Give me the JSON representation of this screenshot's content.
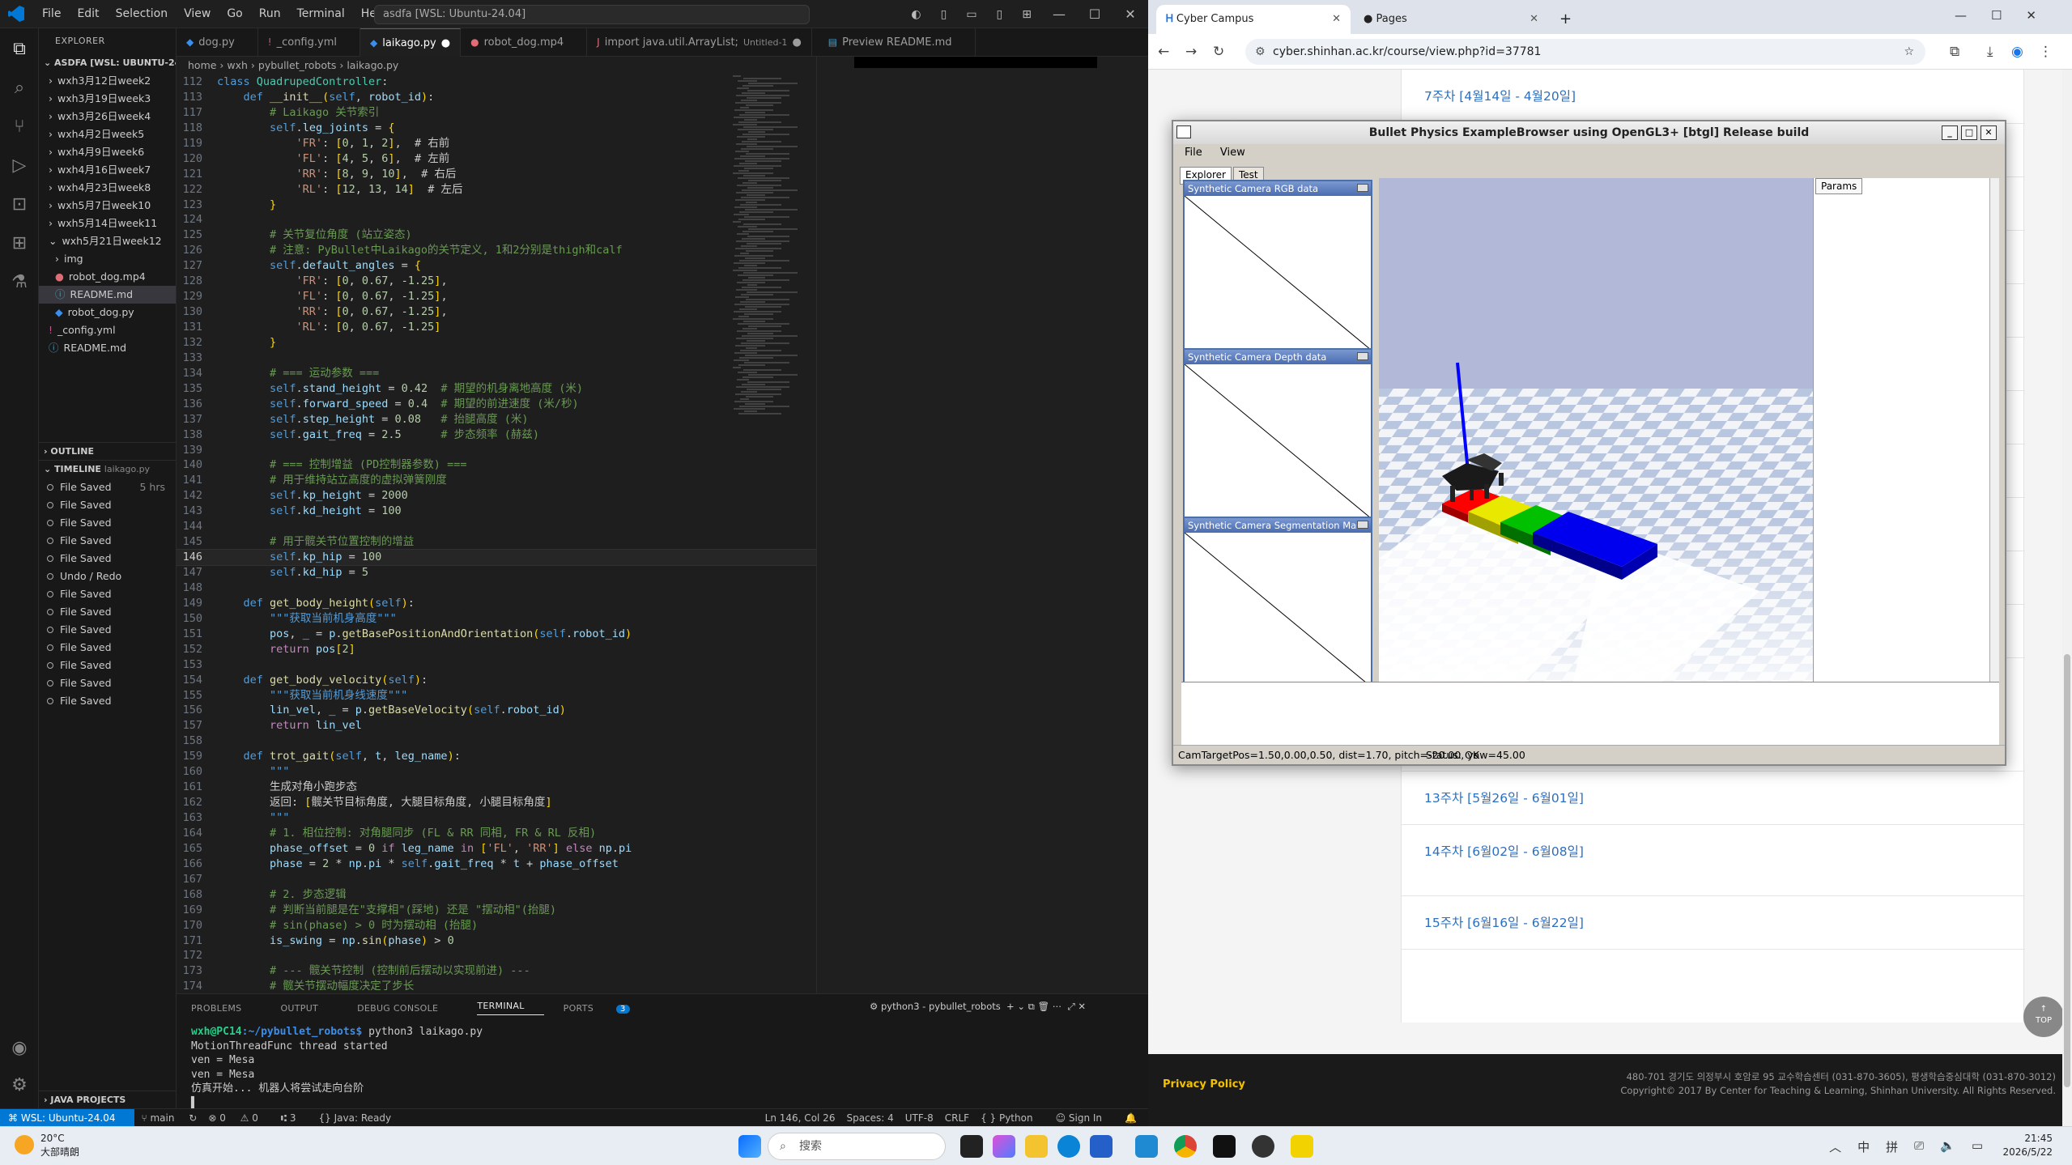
{
  "vscode": {
    "menu": [
      "File",
      "Edit",
      "Selection",
      "View",
      "Go",
      "Run",
      "Terminal",
      "Help"
    ],
    "command_center": "asdfa [WSL: Ubuntu-24.04]",
    "explorer_title": "EXPLORER",
    "workspace": "ASDFA [WSL: UBUNTU-24...",
    "tree": [
      {
        "label": "wxh3月12日week2",
        "indent": 1,
        "kind": "folder"
      },
      {
        "label": "wxh3月19日week3",
        "indent": 1,
        "kind": "folder"
      },
      {
        "label": "wxh3月26日week4",
        "indent": 1,
        "kind": "folder"
      },
      {
        "label": "wxh4月2日week5",
        "indent": 1,
        "kind": "folder"
      },
      {
        "label": "wxh4月9日week6",
        "indent": 1,
        "kind": "folder"
      },
      {
        "label": "wxh4月16日week7",
        "indent": 1,
        "kind": "folder"
      },
      {
        "label": "wxh4月23日week8",
        "indent": 1,
        "kind": "folder"
      },
      {
        "label": "wxh5月7日week10",
        "indent": 1,
        "kind": "folder"
      },
      {
        "label": "wxh5月14日week11",
        "indent": 1,
        "kind": "folder"
      },
      {
        "label": "wxh5月21日week12",
        "indent": 1,
        "kind": "folder-open"
      },
      {
        "label": "img",
        "indent": 2,
        "kind": "folder"
      },
      {
        "label": "robot_dog.mp4",
        "indent": 2,
        "kind": "video"
      },
      {
        "label": "README.md",
        "indent": 2,
        "kind": "info",
        "selected": true
      },
      {
        "label": "robot_dog.py",
        "indent": 2,
        "kind": "python"
      },
      {
        "label": "_config.yml",
        "indent": 1,
        "kind": "yml"
      },
      {
        "label": "README.md",
        "indent": 1,
        "kind": "info"
      }
    ],
    "outline_label": "OUTLINE",
    "timeline_label": "TIMELINE",
    "timeline_file": "laikago.py",
    "timeline": [
      {
        "label": "File Saved",
        "time": "5 hrs"
      },
      {
        "label": "File Saved",
        "time": ""
      },
      {
        "label": "File Saved",
        "time": ""
      },
      {
        "label": "File Saved",
        "time": ""
      },
      {
        "label": "File Saved",
        "time": ""
      },
      {
        "label": "Undo / Redo",
        "time": ""
      },
      {
        "label": "File Saved",
        "time": ""
      },
      {
        "label": "File Saved",
        "time": ""
      },
      {
        "label": "File Saved",
        "time": ""
      },
      {
        "label": "File Saved",
        "time": ""
      },
      {
        "label": "File Saved",
        "time": ""
      },
      {
        "label": "File Saved",
        "time": ""
      },
      {
        "label": "File Saved",
        "time": ""
      }
    ],
    "java_projects": "JAVA PROJECTS",
    "tabs": [
      {
        "label": "dog.py",
        "icon": "python",
        "active": false
      },
      {
        "label": "_config.yml",
        "icon": "yml",
        "active": false
      },
      {
        "label": "laikago.py",
        "icon": "python",
        "active": true,
        "dirty": true
      },
      {
        "label": "robot_dog.mp4",
        "icon": "video",
        "active": false
      },
      {
        "label": "import java.util.ArrayList;",
        "suffix": "Untitled-1",
        "icon": "java",
        "active": false,
        "dirty": true
      },
      {
        "label": "Preview README.md",
        "icon": "preview",
        "active": false
      }
    ],
    "breadcrumb": [
      "home",
      "wxh",
      "pybullet_robots",
      "laikago.py"
    ],
    "current_line": 146,
    "code": [
      {
        "n": 112,
        "t": "class QuadrupedController:"
      },
      {
        "n": 113,
        "t": "    def __init__(self, robot_id):"
      },
      {
        "n": 117,
        "t": "        # Laikago 关节索引"
      },
      {
        "n": 118,
        "t": "        self.leg_joints = {"
      },
      {
        "n": 119,
        "t": "            'FR': [0, 1, 2],  # 右前"
      },
      {
        "n": 120,
        "t": "            'FL': [4, 5, 6],  # 左前"
      },
      {
        "n": 121,
        "t": "            'RR': [8, 9, 10],  # 右后"
      },
      {
        "n": 122,
        "t": "            'RL': [12, 13, 14]  # 左后"
      },
      {
        "n": 123,
        "t": "        }"
      },
      {
        "n": 124,
        "t": ""
      },
      {
        "n": 125,
        "t": "        # 关节复位角度 (站立姿态)"
      },
      {
        "n": 126,
        "t": "        # 注意: PyBullet中Laikago的关节定义, 1和2分别是thigh和calf"
      },
      {
        "n": 127,
        "t": "        self.default_angles = {"
      },
      {
        "n": 128,
        "t": "            'FR': [0, 0.67, -1.25],"
      },
      {
        "n": 129,
        "t": "            'FL': [0, 0.67, -1.25],"
      },
      {
        "n": 130,
        "t": "            'RR': [0, 0.67, -1.25],"
      },
      {
        "n": 131,
        "t": "            'RL': [0, 0.67, -1.25]"
      },
      {
        "n": 132,
        "t": "        }"
      },
      {
        "n": 133,
        "t": ""
      },
      {
        "n": 134,
        "t": "        # === 运动参数 ==="
      },
      {
        "n": 135,
        "t": "        self.stand_height = 0.42  # 期望的机身离地高度 (米)"
      },
      {
        "n": 136,
        "t": "        self.forward_speed = 0.4  # 期望的前进速度 (米/秒)"
      },
      {
        "n": 137,
        "t": "        self.step_height = 0.08   # 抬腿高度 (米)"
      },
      {
        "n": 138,
        "t": "        self.gait_freq = 2.5      # 步态频率 (赫兹)"
      },
      {
        "n": 139,
        "t": ""
      },
      {
        "n": 140,
        "t": "        # === 控制增益 (PD控制器参数) ==="
      },
      {
        "n": 141,
        "t": "        # 用于维持站立高度的虚拟弹簧刚度"
      },
      {
        "n": 142,
        "t": "        self.kp_height = 2000"
      },
      {
        "n": 143,
        "t": "        self.kd_height = 100"
      },
      {
        "n": 144,
        "t": ""
      },
      {
        "n": 145,
        "t": "        # 用于髋关节位置控制的增益"
      },
      {
        "n": 146,
        "t": "        self.kp_hip = 100"
      },
      {
        "n": 147,
        "t": "        self.kd_hip = 5"
      },
      {
        "n": 148,
        "t": ""
      },
      {
        "n": 149,
        "t": "    def get_body_height(self):"
      },
      {
        "n": 150,
        "t": "        \"\"\"获取当前机身高度\"\"\""
      },
      {
        "n": 151,
        "t": "        pos, _ = p.getBasePositionAndOrientation(self.robot_id)"
      },
      {
        "n": 152,
        "t": "        return pos[2]"
      },
      {
        "n": 153,
        "t": ""
      },
      {
        "n": 154,
        "t": "    def get_body_velocity(self):"
      },
      {
        "n": 155,
        "t": "        \"\"\"获取当前机身线速度\"\"\""
      },
      {
        "n": 156,
        "t": "        lin_vel, _ = p.getBaseVelocity(self.robot_id)"
      },
      {
        "n": 157,
        "t": "        return lin_vel"
      },
      {
        "n": 158,
        "t": ""
      },
      {
        "n": 159,
        "t": "    def trot_gait(self, t, leg_name):"
      },
      {
        "n": 160,
        "t": "        \"\"\""
      },
      {
        "n": 161,
        "t": "        生成对角小跑步态"
      },
      {
        "n": 162,
        "t": "        返回: [髋关节目标角度, 大腿目标角度, 小腿目标角度]"
      },
      {
        "n": 163,
        "t": "        \"\"\""
      },
      {
        "n": 164,
        "t": "        # 1. 相位控制: 对角腿同步 (FL & RR 同相, FR & RL 反相)"
      },
      {
        "n": 165,
        "t": "        phase_offset = 0 if leg_name in ['FL', 'RR'] else np.pi"
      },
      {
        "n": 166,
        "t": "        phase = 2 * np.pi * self.gait_freq * t + phase_offset"
      },
      {
        "n": 167,
        "t": ""
      },
      {
        "n": 168,
        "t": "        # 2. 步态逻辑"
      },
      {
        "n": 169,
        "t": "        # 判断当前腿是在\"支撑相\"(踩地) 还是 \"摆动相\"(抬腿)"
      },
      {
        "n": 170,
        "t": "        # sin(phase) > 0 时为摆动相 (抬腿)"
      },
      {
        "n": 171,
        "t": "        is_swing = np.sin(phase) > 0"
      },
      {
        "n": 172,
        "t": ""
      },
      {
        "n": 173,
        "t": "        # --- 髋关节控制 (控制前后摆动以实现前进) ---"
      },
      {
        "n": 174,
        "t": "        # 髋关节摆动幅度决定了步长"
      }
    ],
    "panel_tabs": [
      "PROBLEMS",
      "OUTPUT",
      "DEBUG CONSOLE",
      "TERMINAL",
      "PORTS"
    ],
    "ports_count": "3",
    "terminal_title": "python3 - pybullet_robots",
    "terminal": {
      "prompt_user": "wxh@PC14",
      "prompt_path": ":~/pybullet_robots$",
      "command": " python3 laikago.py",
      "lines": [
        "MotionThreadFunc thread started",
        "ven = Mesa",
        "ven = Mesa",
        "仿真开始... 机器人将尝试走向台阶"
      ]
    },
    "status": {
      "remote": "WSL: Ubuntu-24.04",
      "branch": "main",
      "errors": "0",
      "warnings": "0",
      "ports": "3",
      "java": "Java: Ready",
      "position": "Ln 146, Col 26",
      "spaces": "Spaces: 4",
      "encoding": "UTF-8",
      "eol": "CRLF",
      "language": "Python",
      "signin": "Sign In"
    }
  },
  "chrome": {
    "tabs": [
      {
        "label": "Cyber Campus",
        "active": true
      },
      {
        "label": "Pages",
        "active": false
      }
    ],
    "url": "cyber.shinhan.ac.kr/course/view.php?id=37781",
    "weeks": [
      "7주차 [4월14일 - 4월20일]",
      "13주차 [5월26일 - 6월01일]",
      "14주차 [6월02일 - 6월08일]",
      "15주차 [6월16일 - 6월22일]"
    ],
    "top_label": "TOP",
    "privacy": "Privacy Policy",
    "footer_line1": "480-701 경기도 의정부시 호암로 95 교수학습센터 (031-870-3605), 평생학습중심대학 (031-870-3012)",
    "footer_line2": "Copyright© 2017 By Center for Teaching & Learning, Shinhan University. All Rights Reserved."
  },
  "bullet": {
    "title": "Bullet Physics ExampleBrowser using OpenGL3+ [btgl] Release build",
    "menu": [
      "File",
      "View"
    ],
    "tabs": [
      "Explorer",
      "Test"
    ],
    "cam_panels": [
      "Synthetic Camera RGB data",
      "Synthetic Camera Depth data",
      "Synthetic Camera Segmentation Mask"
    ],
    "params_tab": "Params",
    "status_left": "CamTargetPos=1.50,0.00,0.50, dist=1.70, pitch=-20.00, yaw=45.00",
    "status_right": "Status: OK",
    "stair_colors": [
      "#ff0000",
      "#e8e800",
      "#00c000",
      "#0000ee"
    ]
  },
  "taskbar": {
    "weather_temp": "20°C",
    "weather_desc": "大部晴朗",
    "search": "搜索",
    "ime1": "中",
    "ime2": "拼",
    "time": "21:45",
    "date": "2026/5/22"
  }
}
